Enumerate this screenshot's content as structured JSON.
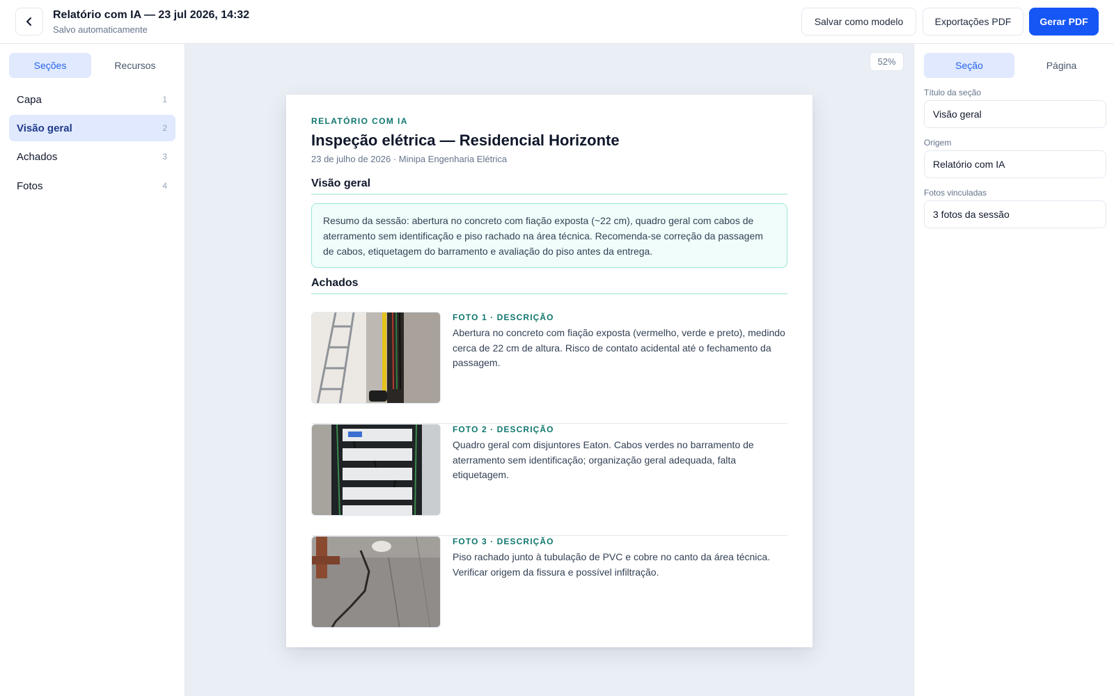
{
  "header": {
    "title": "Relatório com IA — 23 jul 2026, 14:32",
    "subtitle": "Salvo automaticamente",
    "back_icon": "chevron-left-icon",
    "buttons": {
      "save_template": "Salvar como modelo",
      "exports": "Exportações PDF",
      "generate": "Gerar PDF"
    }
  },
  "left_sidebar": {
    "tabs": [
      {
        "label": "Seções",
        "active": true
      },
      {
        "label": "Recursos",
        "active": false
      }
    ],
    "sections": [
      {
        "label": "Capa",
        "number": "1",
        "active": false
      },
      {
        "label": "Visão geral",
        "number": "2",
        "active": true
      },
      {
        "label": "Achados",
        "number": "3",
        "active": false
      },
      {
        "label": "Fotos",
        "number": "4",
        "active": false
      }
    ]
  },
  "canvas": {
    "zoom": "52%",
    "page": {
      "kicker": "RELATÓRIO COM IA",
      "title": "Inspeção elétrica — Residencial Horizonte",
      "meta": "23 de julho de 2026 · Minipa Engenharia Elétrica",
      "overview_heading": "Visão geral",
      "summary": "Resumo da sessão: abertura no concreto com fiação exposta (~22 cm), quadro geral com cabos de aterramento sem identificação e piso rachado na área técnica. Recomenda-se correção da passagem de cabos, etiquetagem do barramento e avaliação do piso antes da entrega.",
      "findings_heading": "Achados",
      "findings": [
        {
          "label": "FOTO 1 · DESCRIÇÃO",
          "text": "Abertura no concreto com fiação exposta (vermelho, verde e preto), medindo cerca de 22 cm de altura. Risco de contato acidental até o fechamento da passagem."
        },
        {
          "label": "FOTO 2 · DESCRIÇÃO",
          "text": "Quadro geral com disjuntores Eaton. Cabos verdes no barramento de aterramento sem identificação; organização geral adequada, falta etiquetagem."
        },
        {
          "label": "FOTO 3 · DESCRIÇÃO",
          "text": "Piso rachado junto à tubulação de PVC e cobre no canto da área técnica. Verificar origem da fissura e possível infiltração."
        }
      ]
    }
  },
  "right_panel": {
    "tabs": [
      {
        "label": "Seção",
        "active": true
      },
      {
        "label": "Página",
        "active": false
      }
    ],
    "fields": [
      {
        "label": "Título da seção",
        "value": "Visão geral"
      },
      {
        "label": "Origem",
        "value": "Relatório com IA"
      },
      {
        "label": "Fotos vinculadas",
        "value": "3 fotos da sessão"
      }
    ]
  },
  "colors": {
    "accent": "#1656f5",
    "active_tab_bg": "#e0e9fd",
    "teal": "#0f766e",
    "canvas_bg": "#eaeff6"
  }
}
